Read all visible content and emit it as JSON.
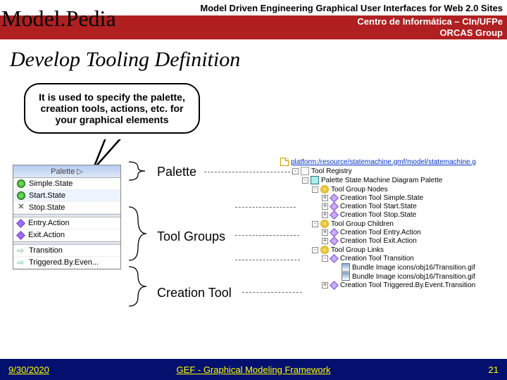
{
  "header": {
    "top_line": "Model Driven Engineering Graphical User Interfaces for Web 2.0 Sites",
    "logo": "Model.Pedia",
    "sub1": "Centro de Informática – CIn/UFPe",
    "sub2": "ORCAS Group"
  },
  "title": "Develop Tooling Definition",
  "callout": "It is used to specify the palette, creation tools, actions, etc. for your graphical elements",
  "palette": {
    "head": "Palette",
    "items": [
      {
        "icon": "green",
        "label": "Simple.State"
      },
      {
        "icon": "green",
        "label": "Start.State"
      },
      {
        "icon": "x",
        "label": "Stop.State"
      },
      {
        "sep": true
      },
      {
        "icon": "diamond",
        "label": "Entry.Action"
      },
      {
        "icon": "diamond",
        "label": "Exit.Action"
      },
      {
        "sep": true
      },
      {
        "icon": "arrow",
        "label": "Transition"
      },
      {
        "icon": "arrow",
        "label": "Triggered.By.Even..."
      }
    ]
  },
  "labels": {
    "l1": "Palette",
    "l2": "Tool Groups",
    "l3": "Creation Tool"
  },
  "tree": {
    "root": "platform:/resource/statemachine.gmf/model/statemachine.g",
    "items": [
      {
        "ind": 1,
        "exp": "-",
        "icon": "reg",
        "label": "Tool Registry"
      },
      {
        "ind": 2,
        "exp": "-",
        "icon": "pal",
        "label": "Palette State Machine Diagram Palette"
      },
      {
        "ind": 3,
        "exp": "-",
        "icon": "grp",
        "label": "Tool Group Nodes"
      },
      {
        "ind": 4,
        "exp": "+",
        "icon": "tool",
        "label": "Creation Tool Simple.State"
      },
      {
        "ind": 4,
        "exp": "+",
        "icon": "tool",
        "label": "Creation Tool Start.State"
      },
      {
        "ind": 4,
        "exp": "+",
        "icon": "tool",
        "label": "Creation Tool Stop.State"
      },
      {
        "ind": 3,
        "exp": "-",
        "icon": "grp",
        "label": "Tool Group Children"
      },
      {
        "ind": 4,
        "exp": "+",
        "icon": "tool",
        "label": "Creation Tool Entry.Action"
      },
      {
        "ind": 4,
        "exp": "+",
        "icon": "tool",
        "label": "Creation Tool Exit.Action"
      },
      {
        "ind": 3,
        "exp": "-",
        "icon": "grp",
        "label": "Tool Group Links"
      },
      {
        "ind": 4,
        "exp": "-",
        "icon": "tool",
        "label": "Creation Tool Transition"
      },
      {
        "ind": 5,
        "exp": "",
        "icon": "img",
        "label": "Bundle Image icons/obj16/Transition.gif"
      },
      {
        "ind": 5,
        "exp": "",
        "icon": "img",
        "label": "Bundle Image icons/obj16/Transition.gif"
      },
      {
        "ind": 4,
        "exp": "+",
        "icon": "tool",
        "label": "Creation Tool Triggered.By.Event.Transition"
      }
    ]
  },
  "footer": {
    "date": "9/30/2020",
    "mid": "GEF - Graphical Modeling Framework",
    "page": "21"
  }
}
